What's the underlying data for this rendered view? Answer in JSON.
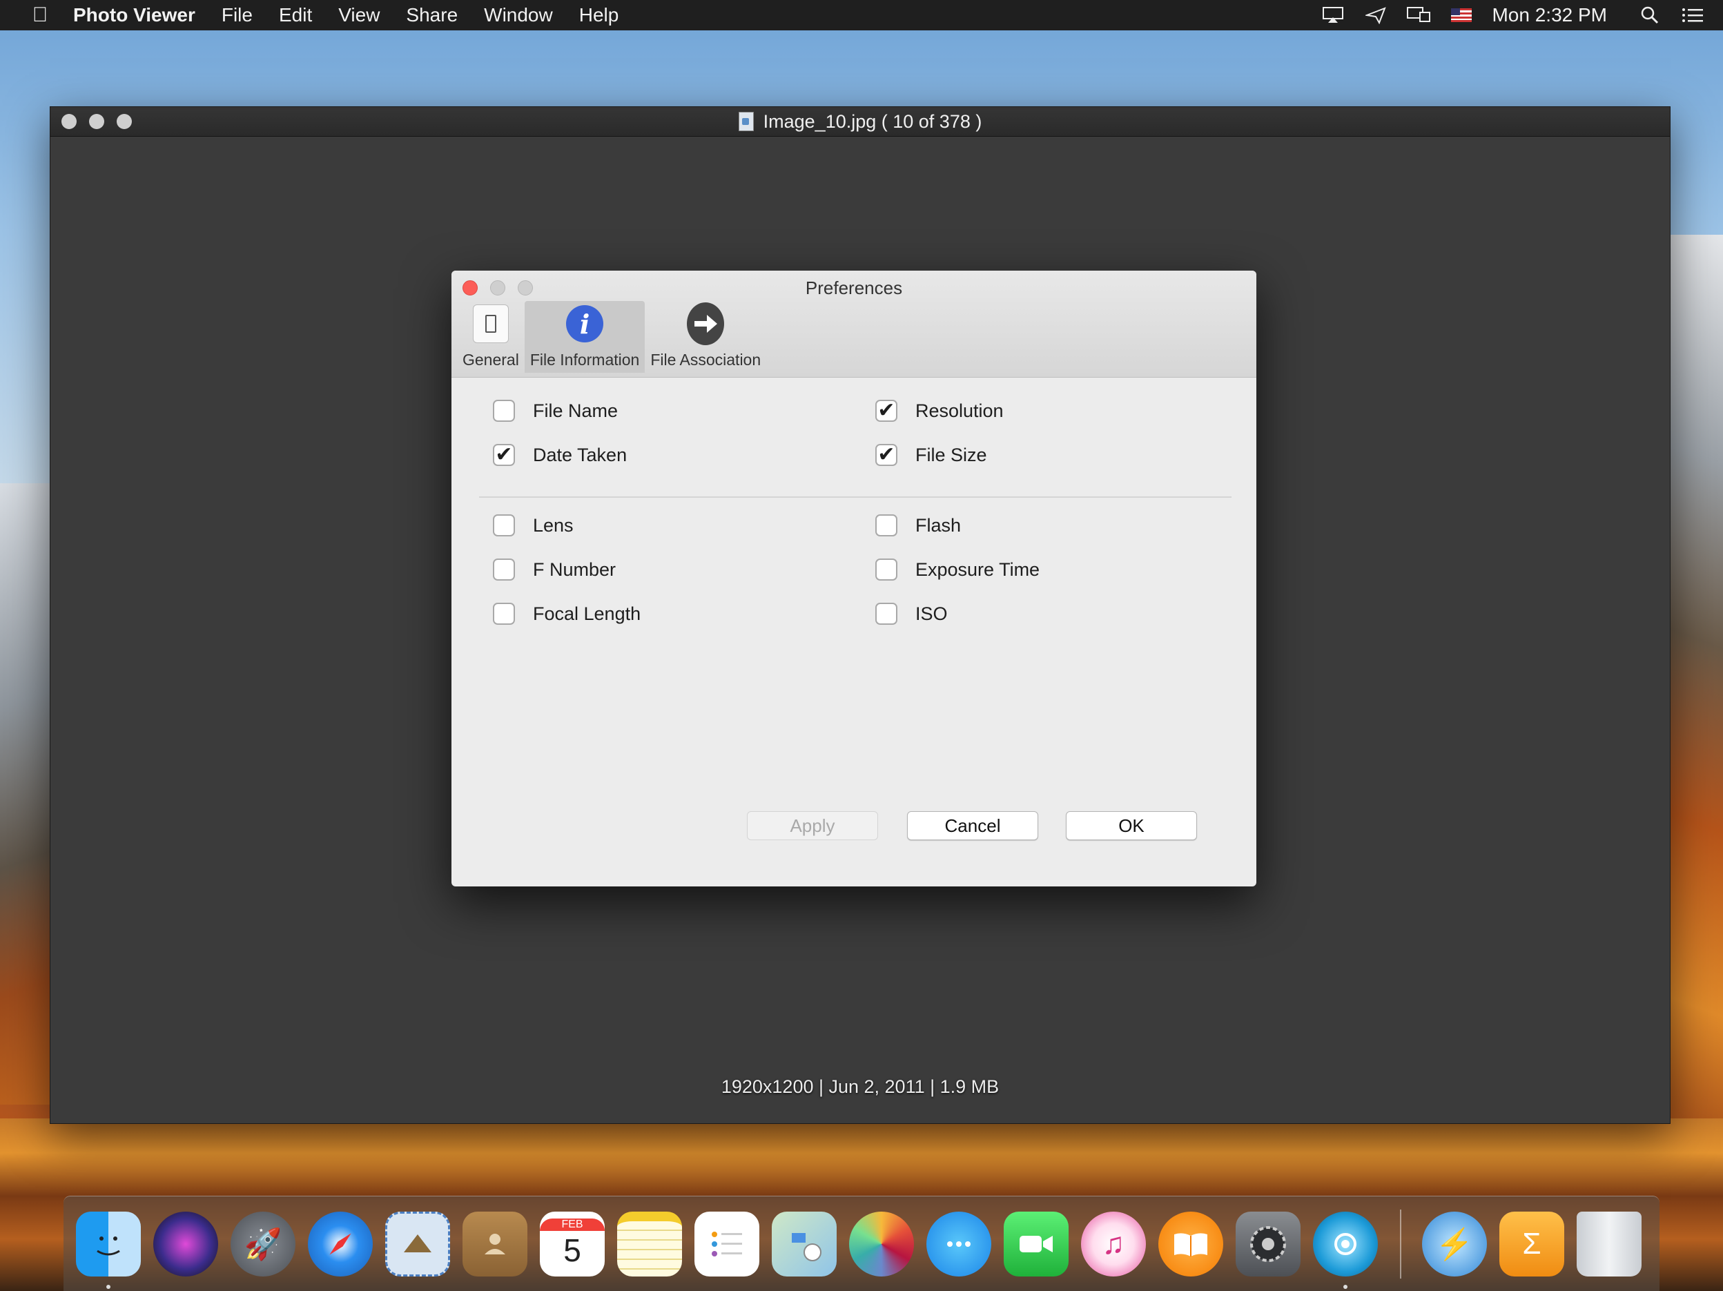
{
  "menubar": {
    "app_name": "Photo Viewer",
    "items": [
      "File",
      "Edit",
      "View",
      "Share",
      "Window",
      "Help"
    ],
    "clock": "Mon 2:32 PM"
  },
  "window": {
    "title": "Image_10.jpg ( 10 of 378 )",
    "caption": "1920x1200 | Jun 2, 2011 | 1.9 MB"
  },
  "prefs": {
    "title": "Preferences",
    "tabs": [
      "General",
      "File Information",
      "File Association"
    ],
    "selected_tab": "File Information",
    "options": {
      "file_name": {
        "label": "File Name",
        "checked": false
      },
      "resolution": {
        "label": "Resolution",
        "checked": true
      },
      "date_taken": {
        "label": "Date Taken",
        "checked": true
      },
      "file_size": {
        "label": "File Size",
        "checked": true
      },
      "lens": {
        "label": "Lens",
        "checked": false
      },
      "flash": {
        "label": "Flash",
        "checked": false
      },
      "f_number": {
        "label": "F Number",
        "checked": false
      },
      "exposure_time": {
        "label": "Exposure Time",
        "checked": false
      },
      "focal_length": {
        "label": "Focal Length",
        "checked": false
      },
      "iso": {
        "label": "ISO",
        "checked": false
      }
    },
    "buttons": {
      "apply": "Apply",
      "cancel": "Cancel",
      "ok": "OK"
    }
  },
  "dock": {
    "calendar_month": "FEB",
    "calendar_day": "5",
    "apps": [
      "finder-icon",
      "siri-icon",
      "launchpad-icon",
      "safari-icon",
      "mail-icon",
      "contacts-icon",
      "calendar-icon",
      "notes-icon",
      "reminders-icon",
      "maps-icon",
      "photos-icon",
      "messages-icon",
      "facetime-icon",
      "itunes-icon",
      "ibooks-icon",
      "system-preferences-icon",
      "photo-viewer-icon",
      "app-icon",
      "folder-icon",
      "trash-icon"
    ]
  }
}
